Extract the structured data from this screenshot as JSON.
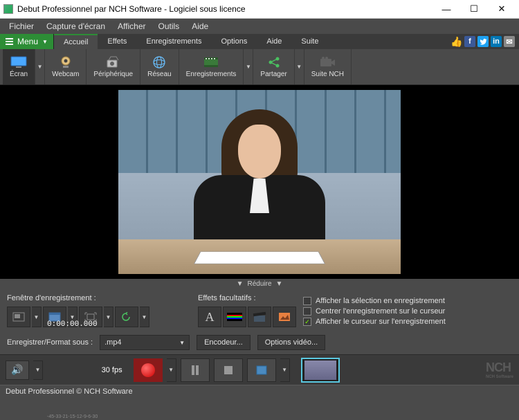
{
  "window": {
    "title": "Debut Professionnel par NCH Software - Logiciel sous licence"
  },
  "menubar": {
    "items": [
      "Fichier",
      "Capture d'écran",
      "Afficher",
      "Outils",
      "Aide"
    ]
  },
  "menu_button": {
    "label": "Menu"
  },
  "ribbon_tabs": {
    "items": [
      "Accueil",
      "Effets",
      "Enregistrements",
      "Options",
      "Aide",
      "Suite"
    ],
    "active_index": 0
  },
  "toolbar": {
    "items": [
      {
        "label": "Écran",
        "icon": "monitor"
      },
      {
        "label": "Webcam",
        "icon": "webcam"
      },
      {
        "label": "Périphérique",
        "icon": "device"
      },
      {
        "label": "Réseau",
        "icon": "network"
      },
      {
        "label": "Enregistrements",
        "icon": "film"
      },
      {
        "label": "Partager",
        "icon": "share"
      },
      {
        "label": "Suite NCH",
        "icon": "camera"
      }
    ]
  },
  "collapse": {
    "label": "Réduire"
  },
  "panels": {
    "recording_window": {
      "label": "Fenêtre d'enregistrement :"
    },
    "effects": {
      "label": "Effets facultatifs :"
    }
  },
  "checkboxes": {
    "show_selection": {
      "label": "Afficher la sélection en enregistrement",
      "checked": false
    },
    "center_cursor": {
      "label": "Centrer l'enregistrement sur le curseur",
      "checked": false
    },
    "show_cursor": {
      "label": "Afficher le curseur sur l'enregistrement",
      "checked": true
    }
  },
  "format": {
    "label": "Enregistrer/Format sous :",
    "value": ".mp4",
    "encoder_btn": "Encodeur...",
    "video_options_btn": "Options vidéo..."
  },
  "transport": {
    "timecode": "0:00:00.000",
    "fps": "30 fps",
    "meter_marks": [
      "-45",
      "-33",
      "-21",
      "-15",
      "-12",
      "-9",
      "-6",
      "-3",
      "0"
    ]
  },
  "logo": {
    "main": "NCH",
    "sub": "NCH Software"
  },
  "statusbar": {
    "text": "Debut Professionnel  © NCH Software"
  }
}
